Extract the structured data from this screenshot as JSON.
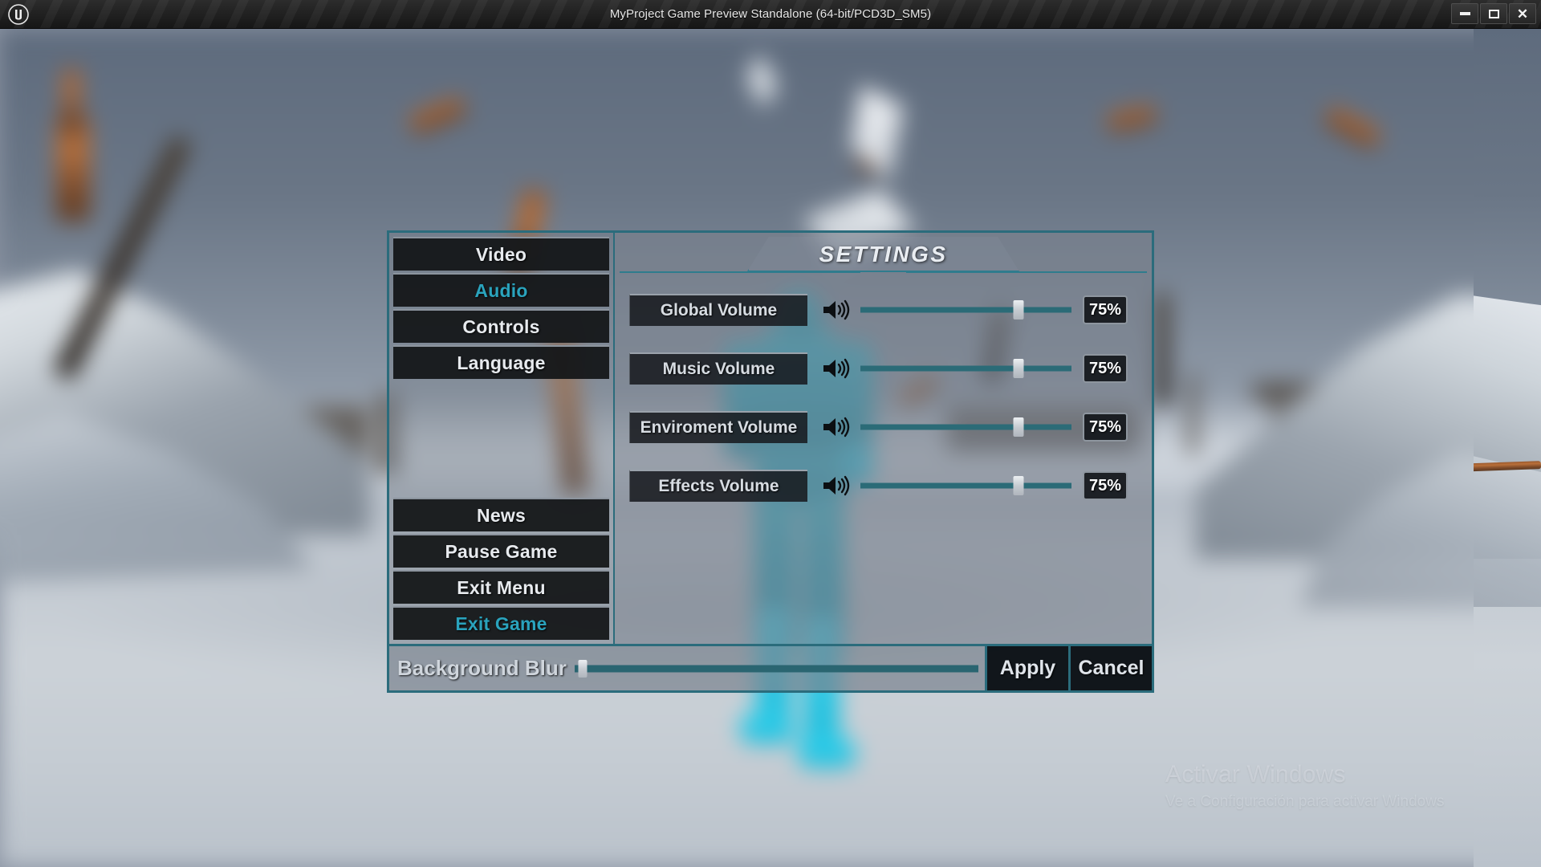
{
  "window": {
    "title": "MyProject Game Preview Standalone (64-bit/PCD3D_SM5)",
    "logo_icon": "unreal-engine-logo",
    "controls": {
      "minimize": "minimize-icon",
      "maximize": "maximize-icon",
      "close": "close-icon"
    }
  },
  "menu": {
    "header": {
      "title": "SETTINGS"
    },
    "sidebar": {
      "top_items": [
        {
          "label": "Video",
          "selected": false
        },
        {
          "label": "Audio",
          "selected": true
        },
        {
          "label": "Controls",
          "selected": false
        },
        {
          "label": "Language",
          "selected": false
        }
      ],
      "bottom_items": [
        {
          "label": "News",
          "selected": false
        },
        {
          "label": "Pause Game",
          "selected": false
        },
        {
          "label": "Exit Menu",
          "selected": false
        },
        {
          "label": "Exit Game",
          "selected": true
        }
      ]
    },
    "audio_rows": [
      {
        "label": "Global Volume",
        "icon": "speaker-icon",
        "value": "75%",
        "percent": 75
      },
      {
        "label": "Music Volume",
        "icon": "speaker-icon",
        "value": "75%",
        "percent": 75
      },
      {
        "label": "Enviroment Volume",
        "icon": "speaker-icon",
        "value": "75%",
        "percent": 75
      },
      {
        "label": "Effects Volume",
        "icon": "speaker-icon",
        "value": "75%",
        "percent": 75
      }
    ],
    "footer": {
      "blur_label": "Background Blur",
      "blur_percent": 2,
      "apply_label": "Apply",
      "cancel_label": "Cancel"
    }
  },
  "watermark": {
    "title": "Activar Windows",
    "subtitle": "Ve a Configuración para activar Windows"
  },
  "colors": {
    "accent_teal": "#2b6c7c",
    "selected_text": "#2aa3bd",
    "track": "#2b6b77",
    "panel_dark": "#12141 7",
    "title_text": "#e9edf2"
  }
}
